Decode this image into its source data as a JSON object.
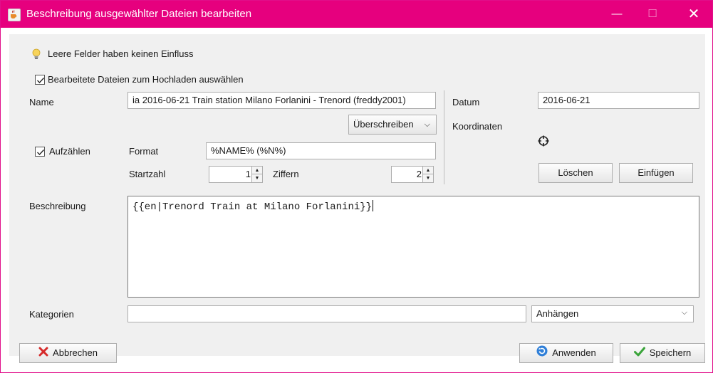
{
  "window": {
    "title": "Beschreibung ausgewählter Dateien bearbeiten",
    "title_icon": "java-cup-icon",
    "controls": {
      "minimize": "—",
      "maximize": "☐",
      "close": "✕"
    },
    "accent_color": "#e6007e"
  },
  "hint": {
    "icon": "lightbulb-icon",
    "text": "Leere Felder haben keinen Einfluss"
  },
  "select_edited": {
    "label": "Bearbeitete Dateien zum Hochladen auswählen",
    "checked": true
  },
  "name": {
    "label": "Name",
    "value": "ia 2016-06-21 Train station Milano Forlanini - Trenord (freddy2001)",
    "mode_button": "Überschreiben"
  },
  "enumerate": {
    "label": "Aufzählen",
    "checked": true,
    "format_label": "Format",
    "format_value": "%NAME% (%N%)",
    "start_label": "Startzahl",
    "start_value": "1",
    "digits_label": "Ziffern",
    "digits_value": "2"
  },
  "date": {
    "label": "Datum",
    "value": "2016-06-21"
  },
  "coordinates": {
    "label": "Koordinaten",
    "icon": "crosshair-icon",
    "clear_button": "Löschen",
    "paste_button": "Einfügen"
  },
  "description": {
    "label": "Beschreibung",
    "value": "{{en|Trenord Train at Milano Forlanini}}"
  },
  "categories": {
    "label": "Kategorien",
    "value": "",
    "mode_selected": "Anhängen"
  },
  "footer": {
    "cancel": "Abbrechen",
    "apply": "Anwenden",
    "save": "Speichern"
  }
}
